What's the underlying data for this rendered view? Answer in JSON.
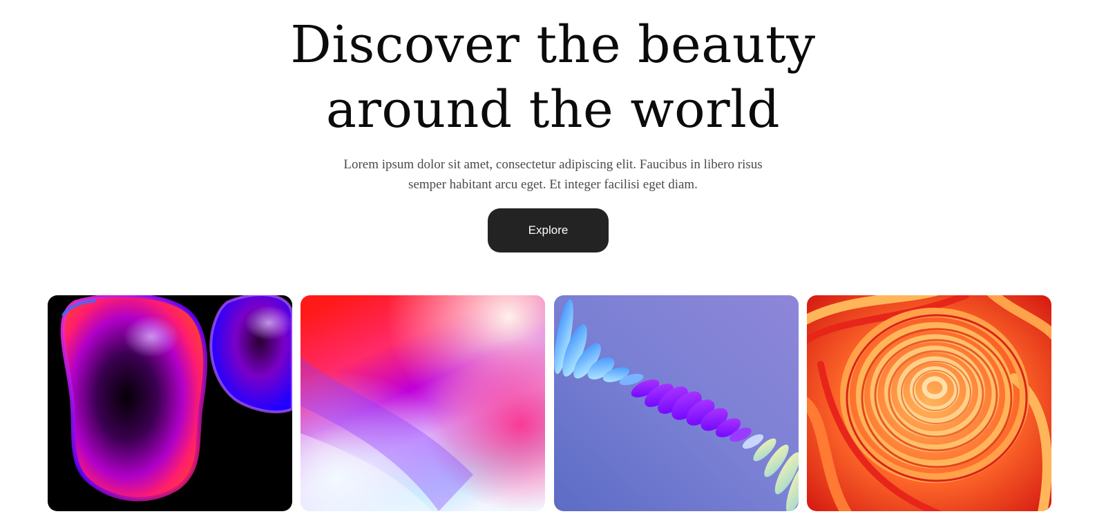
{
  "hero": {
    "title_line1": "Discover the beauty",
    "title_line2": "around the world",
    "description_line1": "Lorem ipsum dolor sit amet, consectetur adipiscing elit. Faucibus in libero risus",
    "description_line2": "semper habitant arcu eget. Et integer facilisi eget diam.",
    "button_label": "Explore"
  },
  "gallery": {
    "images": [
      {
        "icon": "glass-blob-image"
      },
      {
        "icon": "gradient-waves-image"
      },
      {
        "icon": "floating-discs-image"
      },
      {
        "icon": "paper-swirl-image"
      }
    ]
  },
  "colors": {
    "button_bg": "#232323",
    "button_text": "#ffffff",
    "title": "#0b0b0b",
    "body_text": "#4a4a4a"
  }
}
